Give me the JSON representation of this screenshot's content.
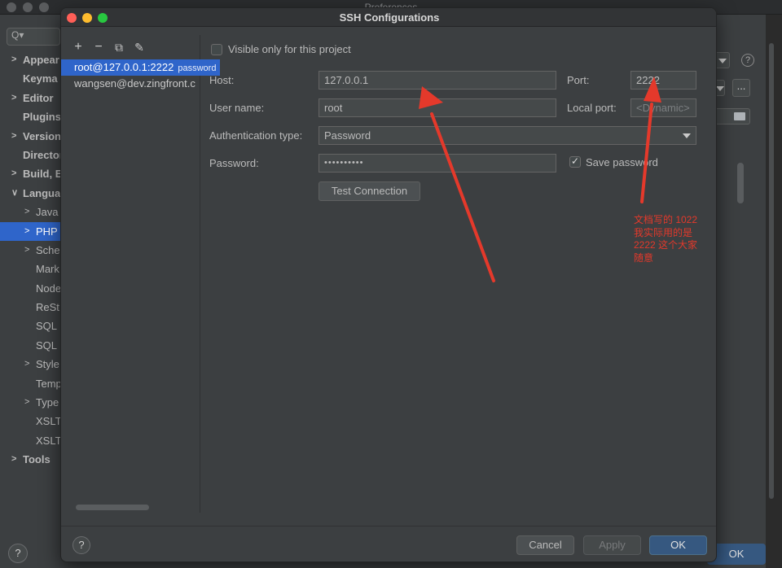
{
  "background": {
    "title": "Preferences",
    "search_icon": "search-icon",
    "tree": [
      {
        "label": "Appear",
        "arrow": ">",
        "bold": true
      },
      {
        "label": "Keyma",
        "arrow": "",
        "bold": true
      },
      {
        "label": "Editor",
        "arrow": ">",
        "bold": true
      },
      {
        "label": "Plugins",
        "arrow": "",
        "bold": true
      },
      {
        "label": "Version",
        "arrow": ">",
        "bold": true
      },
      {
        "label": "Director",
        "arrow": "",
        "bold": true
      },
      {
        "label": "Build, E",
        "arrow": ">",
        "bold": true
      },
      {
        "label": "Langua",
        "arrow": "v",
        "bold": true
      },
      {
        "label": "Java",
        "arrow": ">",
        "bold": false
      },
      {
        "label": "PHP",
        "arrow": ">",
        "bold": false,
        "selected": true
      },
      {
        "label": "Sche",
        "arrow": ">",
        "bold": false
      },
      {
        "label": "Mark",
        "arrow": "",
        "bold": false
      },
      {
        "label": "Node",
        "arrow": "",
        "bold": false
      },
      {
        "label": "ReSt",
        "arrow": "",
        "bold": false
      },
      {
        "label": "SQL",
        "arrow": "",
        "bold": false
      },
      {
        "label": "SQL",
        "arrow": "",
        "bold": false
      },
      {
        "label": "Style",
        "arrow": ">",
        "bold": false
      },
      {
        "label": "Temp",
        "arrow": "",
        "bold": false
      },
      {
        "label": "Type",
        "arrow": ">",
        "bold": false
      },
      {
        "label": "XSLT",
        "arrow": "",
        "bold": false
      },
      {
        "label": "XSLT",
        "arrow": "",
        "bold": false
      },
      {
        "label": "Tools",
        "arrow": ">",
        "bold": true
      }
    ],
    "help_label": "?",
    "ok_label": "OK",
    "more_label": "..."
  },
  "dialog": {
    "title": "SSH Configurations",
    "toolbar": {
      "add": "+",
      "remove": "−",
      "copy": "⧉",
      "edit": "✎"
    },
    "configs": [
      {
        "host": "root@127.0.0.1:2222",
        "auth": "password",
        "selected": true
      },
      {
        "host": "wangsen@dev.zingfront.c",
        "auth": "",
        "selected": false
      }
    ],
    "form": {
      "visible_only_label": "Visible only for this project",
      "host_label": "Host:",
      "host_value": "127.0.0.1",
      "port_label": "Port:",
      "port_value": "2222",
      "username_label": "User name:",
      "username_value": "root",
      "local_port_label": "Local port:",
      "local_port_placeholder": "<Dynamic>",
      "auth_type_label": "Authentication type:",
      "auth_type_value": "Password",
      "password_label": "Password:",
      "password_value": "••••••••••",
      "save_password_label": "Save password",
      "test_connection_label": "Test Connection"
    },
    "footer": {
      "help": "?",
      "cancel": "Cancel",
      "apply": "Apply",
      "ok": "OK"
    }
  },
  "annotation": {
    "note_lines": [
      "文档写的 1022",
      "我实际用的是",
      "2222 这个大家",
      "随意"
    ],
    "arrow_color": "#e4392b"
  }
}
